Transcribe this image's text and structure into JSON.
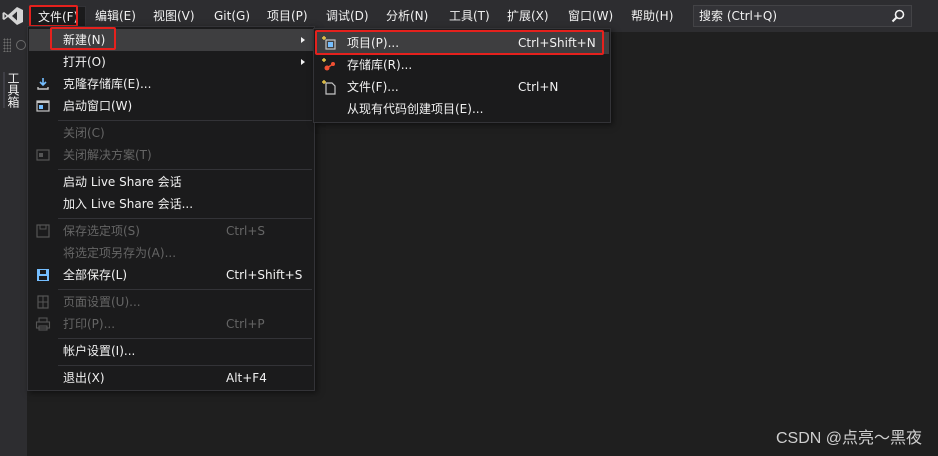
{
  "menubar": {
    "items": [
      {
        "label": "文件(F)"
      },
      {
        "label": "编辑(E)"
      },
      {
        "label": "视图(V)"
      },
      {
        "label": "Git(G)"
      },
      {
        "label": "项目(P)"
      },
      {
        "label": "调试(D)"
      },
      {
        "label": "分析(N)"
      },
      {
        "label": "工具(T)"
      },
      {
        "label": "扩展(X)"
      },
      {
        "label": "窗口(W)"
      },
      {
        "label": "帮助(H)"
      }
    ],
    "search_placeholder": "搜索 (Ctrl+Q)"
  },
  "toolbox": {
    "label": "工具箱"
  },
  "file_menu": {
    "items": [
      {
        "label": "新建(N)",
        "shortcut": "",
        "icon": "none",
        "disabled": false,
        "submenu": true
      },
      {
        "label": "打开(O)",
        "shortcut": "",
        "icon": "none",
        "disabled": false,
        "submenu": true
      },
      {
        "label": "克隆存储库(E)...",
        "shortcut": "",
        "icon": "clone-icon",
        "disabled": false,
        "submenu": false
      },
      {
        "label": "启动窗口(W)",
        "shortcut": "",
        "icon": "start-window-icon",
        "disabled": false,
        "submenu": false
      },
      {
        "label": "关闭(C)",
        "shortcut": "",
        "icon": "none",
        "disabled": true,
        "submenu": false
      },
      {
        "label": "关闭解决方案(T)",
        "shortcut": "",
        "icon": "close-solution-icon",
        "disabled": true,
        "submenu": false
      },
      {
        "label": "启动 Live Share 会话",
        "shortcut": "",
        "icon": "none",
        "disabled": false,
        "submenu": false
      },
      {
        "label": "加入 Live Share 会话...",
        "shortcut": "",
        "icon": "none",
        "disabled": false,
        "submenu": false
      },
      {
        "label": "保存选定项(S)",
        "shortcut": "Ctrl+S",
        "icon": "save-icon",
        "disabled": true,
        "submenu": false
      },
      {
        "label": "将选定项另存为(A)...",
        "shortcut": "",
        "icon": "none",
        "disabled": true,
        "submenu": false
      },
      {
        "label": "全部保存(L)",
        "shortcut": "Ctrl+Shift+S",
        "icon": "save-all-icon",
        "disabled": false,
        "submenu": false
      },
      {
        "label": "页面设置(U)...",
        "shortcut": "",
        "icon": "page-setup-icon",
        "disabled": true,
        "submenu": false
      },
      {
        "label": "打印(P)...",
        "shortcut": "Ctrl+P",
        "icon": "print-icon",
        "disabled": true,
        "submenu": false
      },
      {
        "label": "帐户设置(I)...",
        "shortcut": "",
        "icon": "none",
        "disabled": false,
        "submenu": false
      },
      {
        "label": "退出(X)",
        "shortcut": "Alt+F4",
        "icon": "none",
        "disabled": false,
        "submenu": false
      }
    ]
  },
  "new_submenu": {
    "items": [
      {
        "label": "项目(P)...",
        "shortcut": "Ctrl+Shift+N",
        "icon": "new-project-icon"
      },
      {
        "label": "存储库(R)...",
        "shortcut": "",
        "icon": "repository-icon"
      },
      {
        "label": "文件(F)...",
        "shortcut": "Ctrl+N",
        "icon": "new-file-icon"
      },
      {
        "label": "从现有代码创建项目(E)...",
        "shortcut": "",
        "icon": "none"
      }
    ]
  },
  "watermark": "CSDN @点亮～黑夜",
  "colors": {
    "background": "#1f1f1f",
    "menubar": "#2d2d30",
    "menu_bg": "#1b1b1c",
    "highlight": "#3e3e40",
    "disabled_text": "#656565",
    "annotation_red": "#e5211d",
    "icon_blue": "#75beff"
  }
}
